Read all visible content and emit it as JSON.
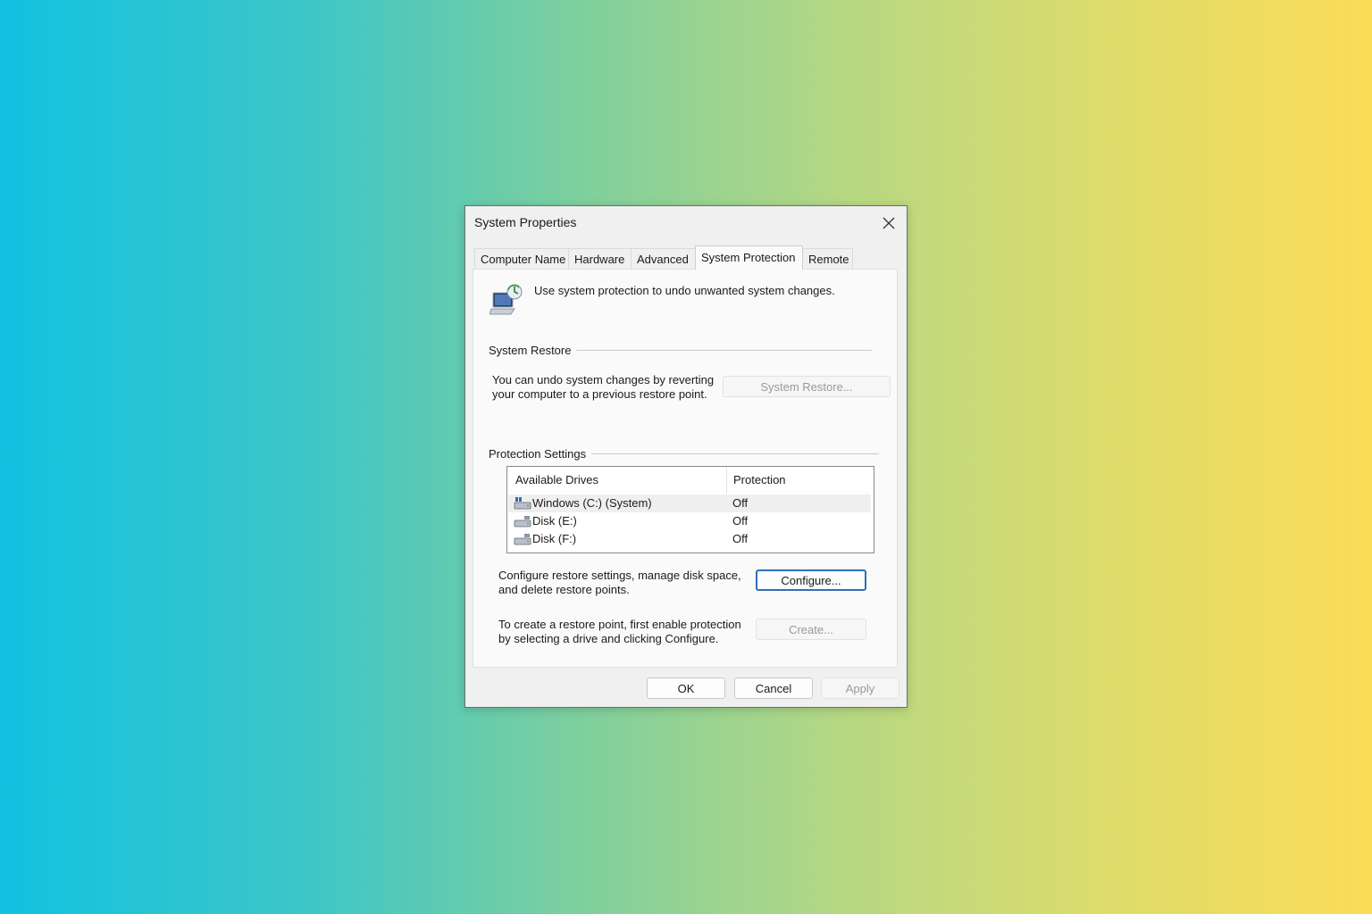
{
  "window": {
    "title": "System Properties"
  },
  "tabs": [
    {
      "label": "Computer Name"
    },
    {
      "label": "Hardware"
    },
    {
      "label": "Advanced"
    },
    {
      "label": "System Protection",
      "active": true
    },
    {
      "label": "Remote"
    }
  ],
  "intro": {
    "text": "Use system protection to undo unwanted system changes."
  },
  "system_restore": {
    "group_label": "System Restore",
    "description_line1": "You can undo system changes by reverting",
    "description_line2": "your computer to a previous restore point.",
    "button_label": "System Restore..."
  },
  "protection_settings": {
    "group_label": "Protection Settings",
    "columns": {
      "drives": "Available Drives",
      "protection": "Protection"
    },
    "drives": [
      {
        "name": "Windows (C:) (System)",
        "protection": "Off",
        "selected": true
      },
      {
        "name": "Disk (E:)",
        "protection": "Off"
      },
      {
        "name": "Disk (F:)",
        "protection": "Off"
      }
    ],
    "configure_text_line1": "Configure restore settings, manage disk space,",
    "configure_text_line2": "and delete restore points.",
    "configure_button": "Configure...",
    "create_text_line1": "To create a restore point, first enable protection",
    "create_text_line2": "by selecting a drive and clicking Configure.",
    "create_button": "Create..."
  },
  "footer": {
    "ok": "OK",
    "cancel": "Cancel",
    "apply": "Apply"
  },
  "icons": {
    "close": "close-icon",
    "header": "system-protection-icon",
    "drive": "drive-icon"
  },
  "colors": {
    "accent": "#2f6fb5",
    "dialog_bg": "#f0f0f0",
    "panel_bg": "#fafafa"
  }
}
